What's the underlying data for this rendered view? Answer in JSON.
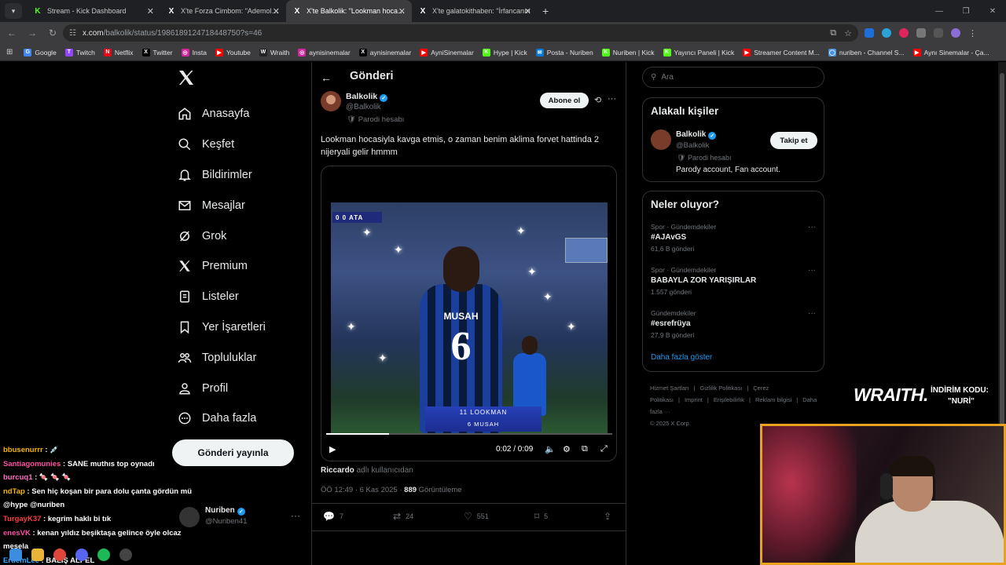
{
  "browser": {
    "tabs": [
      {
        "title": "Stream - Kick Dashboard",
        "icon": "K",
        "color": "#53fc18",
        "active": false
      },
      {
        "title": "X'te Forza Cimbom: \"Ademola Lookman",
        "icon": "X",
        "color": "#ffffff",
        "active": false
      },
      {
        "title": "X'te Balkolik: \"Lookman hocasiyla",
        "icon": "X",
        "color": "#ffffff",
        "active": true
      },
      {
        "title": "X'te galatokithaben: \"İrfancanın",
        "icon": "X",
        "color": "#ffffff",
        "active": false
      }
    ],
    "new_tab": "+",
    "url_host": "x.com",
    "url_path": "/balkolik/status/1986189124718448750?s=46",
    "bookmarks": [
      {
        "label": "Google",
        "icon": "G",
        "color": "#4285f4"
      },
      {
        "label": "Twitch",
        "icon": "T",
        "color": "#9146ff"
      },
      {
        "label": "Netflix",
        "icon": "N",
        "color": "#e50914"
      },
      {
        "label": "Twitter",
        "icon": "X",
        "color": "#000000"
      },
      {
        "label": "Insta",
        "icon": "◎",
        "color": "#d6249f"
      },
      {
        "label": "Youtube",
        "icon": "▶",
        "color": "#ff0000"
      },
      {
        "label": "Wraith",
        "icon": "W",
        "color": "#222222"
      },
      {
        "label": "aynisinemalar",
        "icon": "◎",
        "color": "#d6249f"
      },
      {
        "label": "aynisinemalar",
        "icon": "X",
        "color": "#000000"
      },
      {
        "label": "AyniSinemalar",
        "icon": "▶",
        "color": "#ff0000"
      },
      {
        "label": "Hype | Kick",
        "icon": "K",
        "color": "#53fc18"
      },
      {
        "label": "Posta - Nuriben",
        "icon": "✉",
        "color": "#0078d4"
      },
      {
        "label": "Nuriben | Kick",
        "icon": "K",
        "color": "#53fc18"
      },
      {
        "label": "Yayıncı Paneli | Kick",
        "icon": "K",
        "color": "#53fc18"
      },
      {
        "label": "Streamer Content M...",
        "icon": "▶",
        "color": "#ff0000"
      },
      {
        "label": "nuriben - Channel S...",
        "icon": "◯",
        "color": "#4a90e2"
      },
      {
        "label": "Aynı Sinemalar - Ça...",
        "icon": "▶",
        "color": "#ff0000"
      }
    ]
  },
  "nav": {
    "items": [
      {
        "label": "Anasayfa",
        "icon": "home"
      },
      {
        "label": "Keşfet",
        "icon": "search"
      },
      {
        "label": "Bildirimler",
        "icon": "bell"
      },
      {
        "label": "Mesajlar",
        "icon": "mail"
      },
      {
        "label": "Grok",
        "icon": "grok"
      },
      {
        "label": "Premium",
        "icon": "x"
      },
      {
        "label": "Listeler",
        "icon": "list"
      },
      {
        "label": "Yer İşaretleri",
        "icon": "bookmark"
      },
      {
        "label": "Topluluklar",
        "icon": "people"
      },
      {
        "label": "Profil",
        "icon": "person"
      },
      {
        "label": "Daha fazla",
        "icon": "more"
      }
    ],
    "post_button": "Gönderi yayınla",
    "account": {
      "name": "Nuriben",
      "handle": "@Nuriben41"
    }
  },
  "chat": [
    {
      "user": "bbusenurrr",
      "color": "#f5b400",
      "msg": " : 💉"
    },
    {
      "user": "Santiagomunies",
      "color": "#ff4fa3",
      "msg": " : SANE muthıs top oynadı"
    },
    {
      "user": "burcuq1",
      "color": "#ff6ec7",
      "msg": " : 🍬 🍬 🍬"
    },
    {
      "user": "ndTap",
      "color": "#f5b400",
      "msg": " : Sen hiç koşan bir para dolu çanta gördün mü @hype @nuriben"
    },
    {
      "user": "TurgayK37",
      "color": "#ff3b3b",
      "msg": " : kegrim haklı bi tık"
    },
    {
      "user": "enesVK",
      "color": "#ff4fa3",
      "msg": " : kenan yıldız beşiktaşa gelince öyle olcaz mesela"
    },
    {
      "user": "ErdemLee",
      "color": "#3da9ff",
      "msg": " : BALIŞ ALPEL"
    }
  ],
  "post": {
    "header_title": "Gönderi",
    "author_name": "Balkolik",
    "author_handle": "@Balkolik",
    "parody_label": "Parodi hesabı",
    "subscribe_label": "Abone ol",
    "text": "Lookman hocasiyla kavga etmis, o zaman benim aklima forvet hattinda 2 nijeryali gelir hmmm",
    "video": {
      "scoreboard": "0  0  ATA",
      "jersey_name": "MUSAH",
      "jersey_number": "6",
      "lower_third_1": "11 LOOKMAN",
      "lower_third_2": "6 MUSAH",
      "time": "0:02 / 0:09",
      "progress": 0.22
    },
    "source_user": "Riccardo",
    "source_suffix": " adlı kullanıcıdan",
    "time": "ÖÖ 12:49 · 6 Kas 2025 · ",
    "views_count": "889",
    "views_label": " Görüntüleme",
    "replies": "7",
    "reposts": "24",
    "likes": "551",
    "bookmarks": "5"
  },
  "sidebar": {
    "search_placeholder": "Ara",
    "relevant_title": "Alakalı kişiler",
    "person": {
      "name": "Balkolik",
      "handle": "@Balkolik",
      "parody": "Parodi hesabı",
      "bio": "Parody account, Fan account.",
      "follow_label": "Takip et"
    },
    "trending_title": "Neler oluyor?",
    "trends": [
      {
        "category": "Spor · Gündemdekiler",
        "name": "#AJAvGS",
        "count": "61,6 B gönderi"
      },
      {
        "category": "Spor · Gündemdekiler",
        "name": "BABAYLA ZOR YARIŞIRLAR",
        "count": "1.557 gönderi"
      },
      {
        "category": "Gündemdekiler",
        "name": "#esrefrüya",
        "count": "27,9 B gönderi"
      }
    ],
    "show_more": "Daha fazla göster",
    "footer_links": [
      "Hizmet Şartları",
      "|",
      "Gizlilik Politikası",
      "|",
      "Çerez Politikası",
      "|",
      "Imprint",
      "|",
      "Erişilebilirlik",
      "|",
      "Reklam bilgisi",
      "|",
      "Daha fazla ···"
    ],
    "copyright": "© 2025 X Corp."
  },
  "overlay": {
    "brand": "WRAITH.",
    "promo_label": "İNDİRİM KODU:",
    "promo_code": "\"NURİ\""
  }
}
